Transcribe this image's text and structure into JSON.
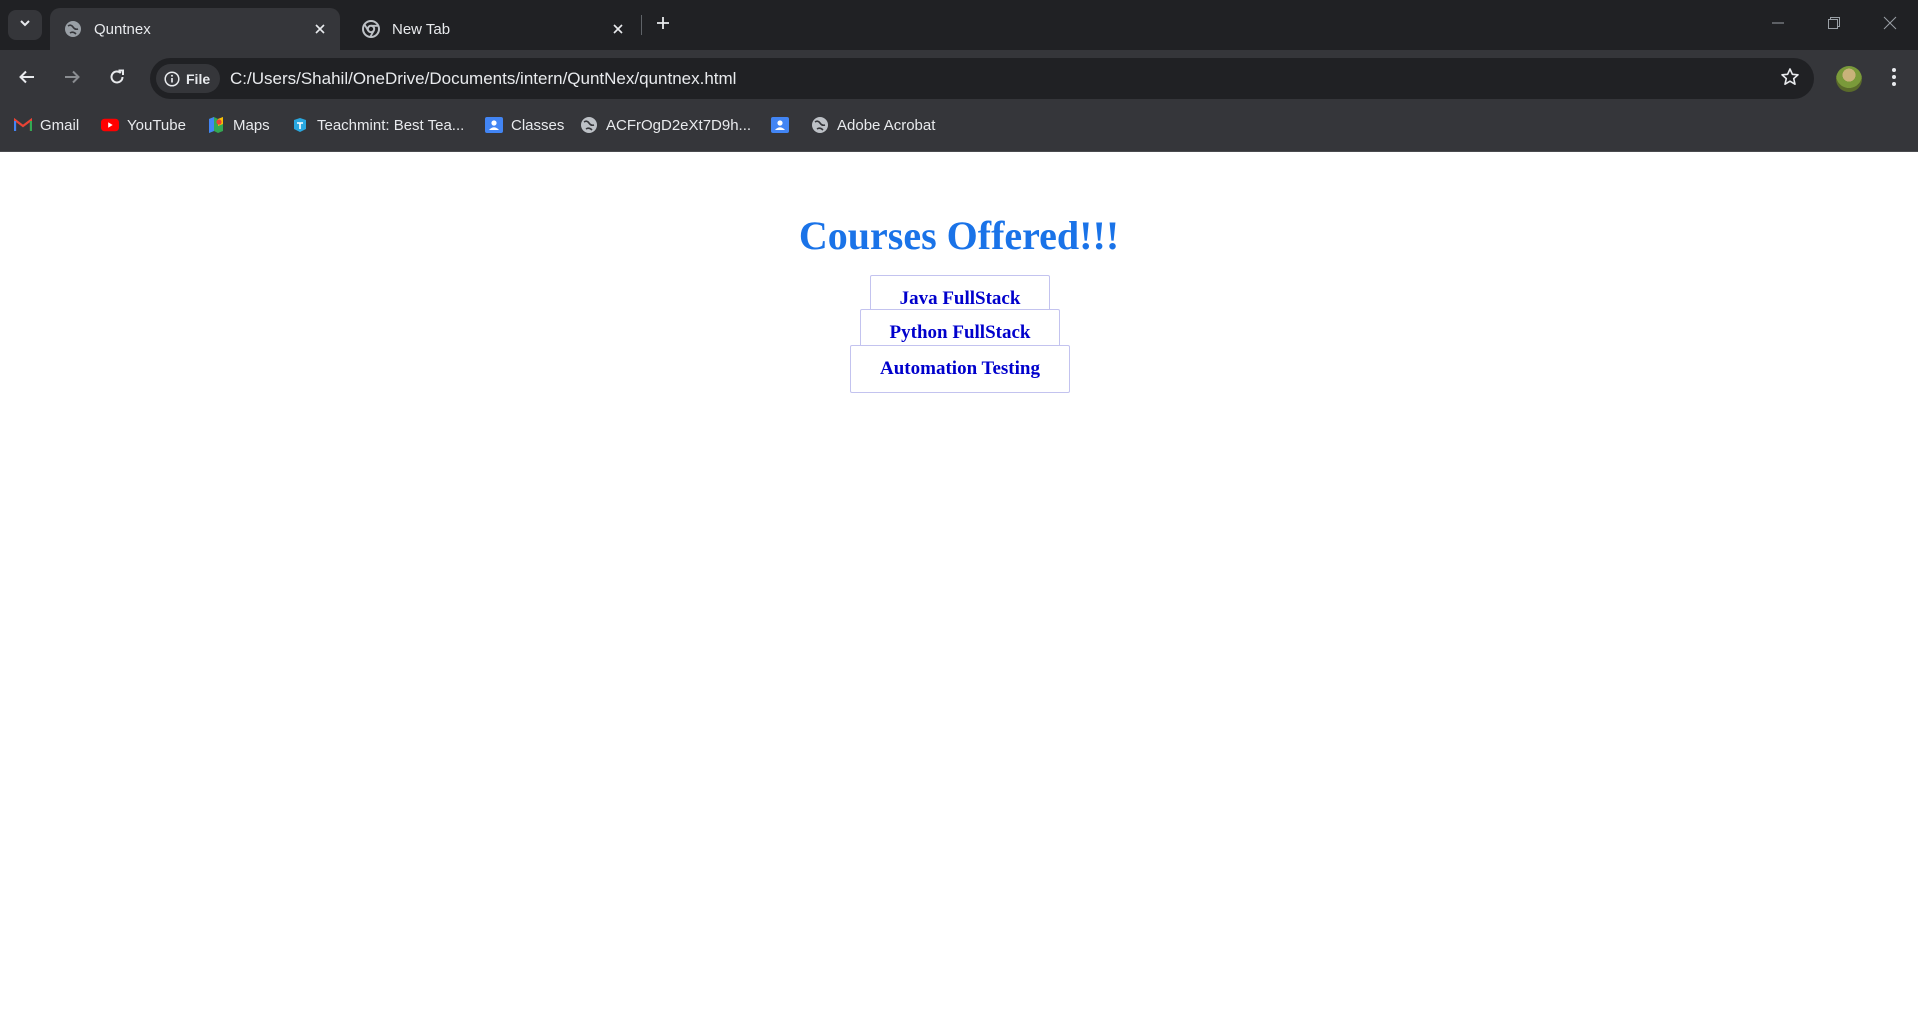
{
  "browser": {
    "tabs": [
      {
        "title": "Quntnex",
        "active": true
      },
      {
        "title": "New Tab",
        "active": false
      }
    ],
    "address": {
      "chip_label": "File",
      "url": "C:/Users/Shahil/OneDrive/Documents/intern/QuntNex/quntnex.html"
    },
    "bookmarks": [
      {
        "label": "Gmail",
        "icon": "gmail-icon"
      },
      {
        "label": "YouTube",
        "icon": "youtube-icon"
      },
      {
        "label": "Maps",
        "icon": "maps-icon"
      },
      {
        "label": "Teachmint: Best Tea...",
        "icon": "teachmint-icon"
      },
      {
        "label": "Classes",
        "icon": "classroom-icon"
      },
      {
        "label": "ACFrOgD2eXt7D9h...",
        "icon": "globe-icon"
      },
      {
        "label": "",
        "icon": "classroom-icon"
      },
      {
        "label": "Adobe Acrobat",
        "icon": "globe-icon"
      }
    ]
  },
  "page": {
    "heading": "Courses Offered!!!",
    "courses": [
      "Java FullStack",
      "Python FullStack",
      "Automation Testing"
    ],
    "colors": {
      "heading": "#1a73e8",
      "course_text": "#0000cc",
      "course_border": "#c3c3ef"
    }
  }
}
